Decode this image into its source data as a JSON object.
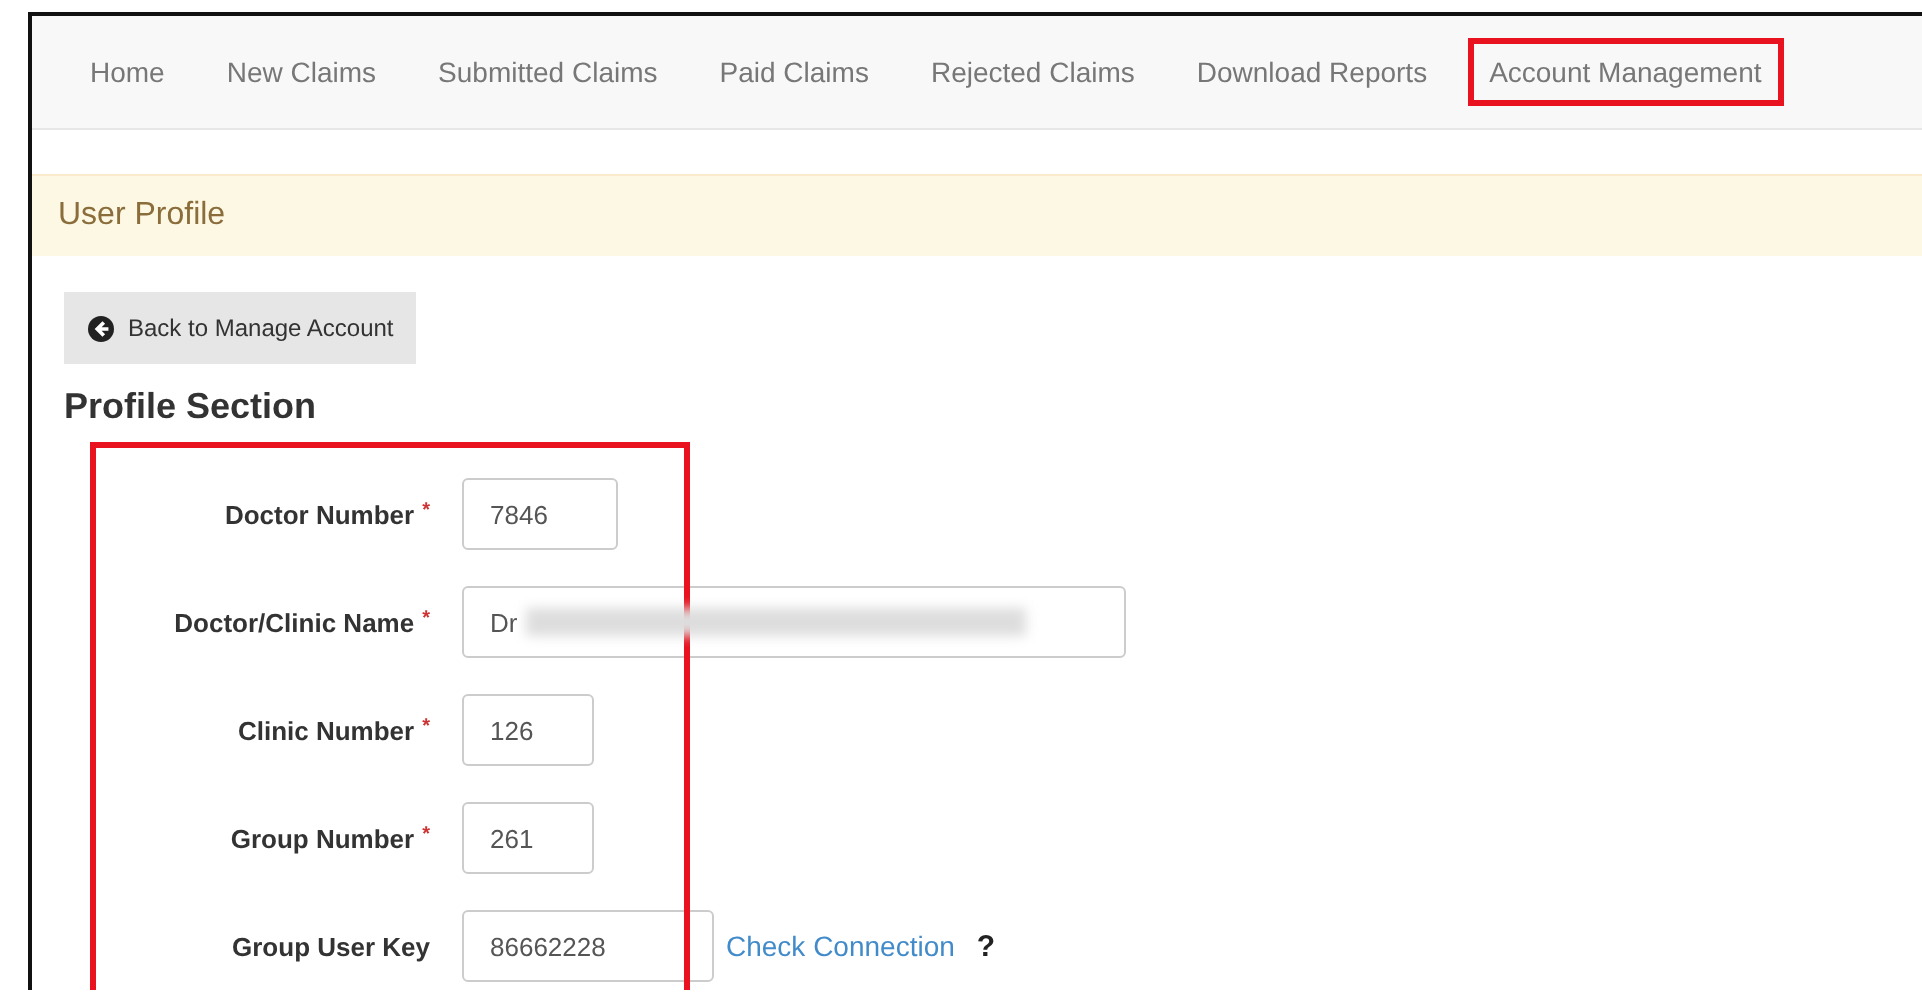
{
  "nav": {
    "items": [
      {
        "label": "Home",
        "selected": false,
        "highlighted": false
      },
      {
        "label": "New Claims",
        "selected": false,
        "highlighted": false
      },
      {
        "label": "Submitted Claims",
        "selected": false,
        "highlighted": false
      },
      {
        "label": "Paid Claims",
        "selected": false,
        "highlighted": false
      },
      {
        "label": "Rejected Claims",
        "selected": false,
        "highlighted": false
      },
      {
        "label": "Download Reports",
        "selected": false,
        "highlighted": false
      },
      {
        "label": "Account Management",
        "selected": false,
        "highlighted": true
      }
    ]
  },
  "panel": {
    "title": "User Profile"
  },
  "back_button": {
    "label": "Back to Manage Account"
  },
  "section": {
    "title": "Profile Section",
    "highlighted": true,
    "fields": [
      {
        "label": "Doctor Number",
        "required": "*",
        "value": "7846",
        "redacted": false
      },
      {
        "label": "Doctor/Clinic Name",
        "required": "*",
        "value": "Dr",
        "redacted": true
      },
      {
        "label": "Clinic Number",
        "required": "*",
        "value": "126",
        "redacted": false
      },
      {
        "label": "Group Number",
        "required": "*",
        "value": "261",
        "redacted": false
      },
      {
        "label": "Group User Key",
        "value": "86662228",
        "redacted": false,
        "link": "Check Connection",
        "help": "?"
      }
    ]
  }
}
